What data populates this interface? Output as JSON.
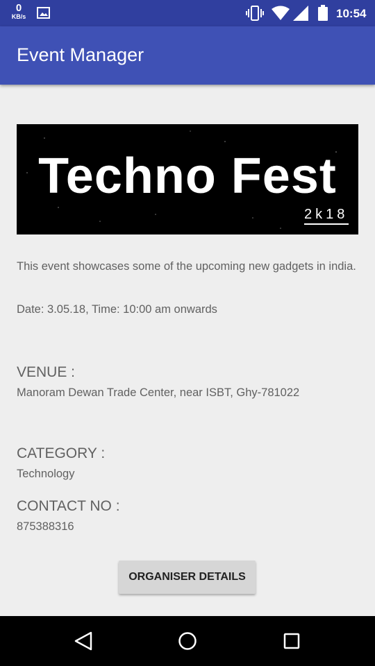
{
  "status_bar": {
    "network_speed_value": "0",
    "network_speed_unit": "KB/s",
    "time": "10:54",
    "icons": [
      "gallery-icon",
      "vibrate-icon",
      "wifi-icon",
      "signal-icon",
      "battery-icon"
    ]
  },
  "app_bar": {
    "title": "Event Manager"
  },
  "banner": {
    "title": "Techno Fest",
    "year": "2k18"
  },
  "event": {
    "description": "This event showcases some of the upcoming new gadgets in india.",
    "datetime": "Date: 3.05.18, Time: 10:00 am onwards"
  },
  "venue": {
    "label": "VENUE :",
    "value": "Manoram Dewan Trade Center, near ISBT, Ghy-781022"
  },
  "category": {
    "label": "CATEGORY :",
    "value": "Technology"
  },
  "contact": {
    "label": "CONTACT NO :",
    "value": "875388316"
  },
  "organiser_button": {
    "label": "ORGANISER DETAILS"
  },
  "nav_bar": {
    "icons": [
      "back-icon",
      "home-icon",
      "recents-icon"
    ]
  },
  "colors": {
    "status_bar": "#303f9f",
    "app_bar": "#3f51b5",
    "background": "#eeeeee",
    "text": "#616161",
    "button": "#d6d6d6"
  }
}
